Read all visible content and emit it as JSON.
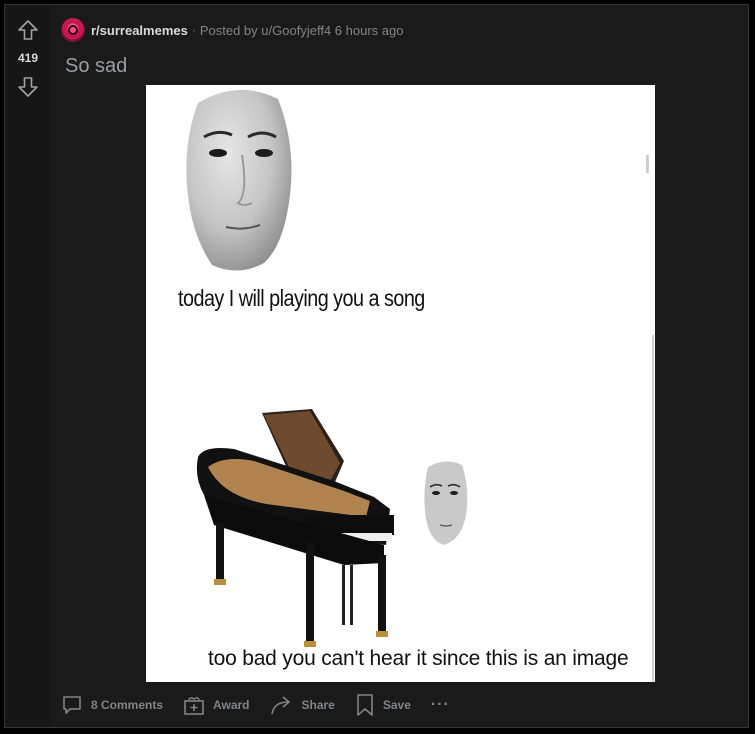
{
  "post": {
    "score": "419",
    "subreddit": "r/surrealmemes",
    "separator": "·",
    "posted_prefix": "Posted by",
    "author": "u/Goofyjeff4",
    "time_ago": "6 hours ago",
    "title": "So sad"
  },
  "image": {
    "caption_top": "today I will playing you a song",
    "caption_bottom": "too bad you can't hear it since this is an image"
  },
  "actions": {
    "comments": "8 Comments",
    "award": "Award",
    "share": "Share",
    "save": "Save",
    "more": "···"
  },
  "colors": {
    "background": "#1a1a1b",
    "text_primary": "#d7dadc",
    "text_muted": "#818384",
    "subreddit_accent": "#e0245e"
  }
}
